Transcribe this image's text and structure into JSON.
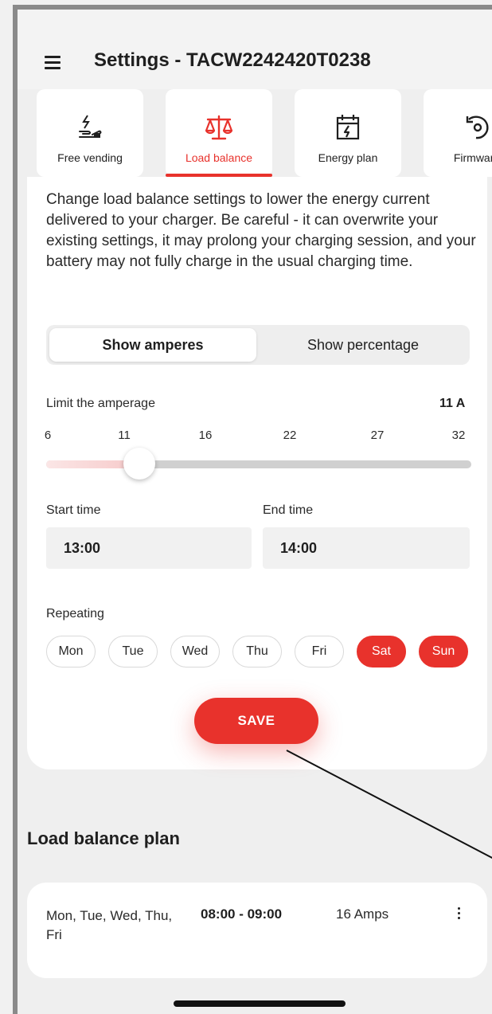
{
  "header": {
    "title": "Settings - TACW2242420T0238",
    "menu_icon": "hamburger-menu-icon"
  },
  "tabs": [
    {
      "label": "Free vending",
      "icon": "hand-lightning-icon",
      "active": false
    },
    {
      "label": "Load balance",
      "icon": "balance-scale-icon",
      "active": true
    },
    {
      "label": "Energy plan",
      "icon": "calendar-lightning-icon",
      "active": false
    },
    {
      "label": "Firmware",
      "icon": "firmware-update-icon",
      "active": false
    }
  ],
  "description": "Change load balance settings to lower the energy current delivered to your charger. Be careful - it can overwrite your existing settings, it may prolong your charging session, and your battery may not fully charge in the usual charging time.",
  "display_toggle": {
    "option_on": "Show amperes",
    "option_off": "Show percentage"
  },
  "limit": {
    "label": "Limit the amperage",
    "value_text": "11 A",
    "value": 11,
    "min": 6,
    "max": 32,
    "ticks": [
      "6",
      "11",
      "16",
      "22",
      "27",
      "32"
    ]
  },
  "schedule": {
    "start_label": "Start time",
    "start_value": "13:00",
    "end_label": "End time",
    "end_value": "14:00"
  },
  "repeating": {
    "label": "Repeating",
    "days": [
      {
        "label": "Mon",
        "selected": false
      },
      {
        "label": "Tue",
        "selected": false
      },
      {
        "label": "Wed",
        "selected": false
      },
      {
        "label": "Thu",
        "selected": false
      },
      {
        "label": "Fri",
        "selected": false
      },
      {
        "label": "Sat",
        "selected": true
      },
      {
        "label": "Sun",
        "selected": true
      }
    ]
  },
  "save_label": "SAVE",
  "plan": {
    "title": "Load balance plan",
    "entry": {
      "days": "Mon, Tue, Wed, Thu, Fri",
      "time": "08:00 - 09:00",
      "amps": "16 Amps"
    }
  },
  "colors": {
    "accent": "#e8322c",
    "background": "#efefef",
    "card": "#ffffff"
  }
}
